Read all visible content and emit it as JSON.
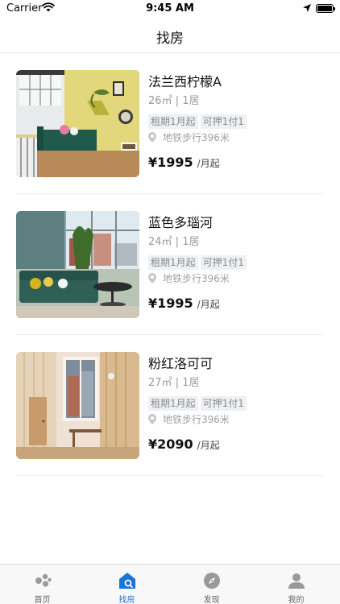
{
  "status_bar": {
    "carrier": "Carrier",
    "time": "9:45 AM"
  },
  "nav": {
    "title": "找房"
  },
  "listings": [
    {
      "title": "法兰西柠檬A",
      "area": "26㎡",
      "layout": "1居",
      "tags": [
        "租期1月起",
        "可押1付1"
      ],
      "distance": "地铁步行396米",
      "price": "¥1995",
      "price_unit": "/月起"
    },
    {
      "title": "蓝色多瑙河",
      "area": "24㎡",
      "layout": "1居",
      "tags": [
        "租期1月起",
        "可押1付1"
      ],
      "distance": "地铁步行396米",
      "price": "¥1995",
      "price_unit": "/月起"
    },
    {
      "title": "粉红洛可可",
      "area": "27㎡",
      "layout": "1居",
      "tags": [
        "租期1月起",
        "可押1付1"
      ],
      "distance": "地铁步行396米",
      "price": "¥2090",
      "price_unit": "/月起"
    }
  ],
  "tab_bar": {
    "items": [
      {
        "label": "首页",
        "icon": "home-dots-icon"
      },
      {
        "label": "找房",
        "icon": "house-search-icon"
      },
      {
        "label": "发现",
        "icon": "compass-icon"
      },
      {
        "label": "我的",
        "icon": "person-icon"
      }
    ],
    "active_index": 1
  },
  "colors": {
    "accent": "#1a73d9",
    "tab_inactive": "#9a9a9a"
  }
}
